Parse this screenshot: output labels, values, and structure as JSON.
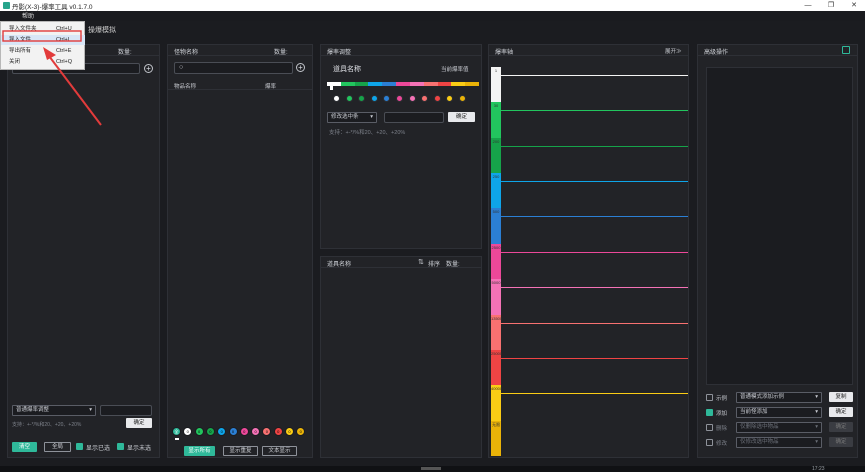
{
  "window": {
    "title": "丹影(X-3)-爆率工具 v0.1.7.0",
    "controls": [
      "—",
      "❐",
      "✕"
    ],
    "menu_help": "帮助",
    "side_hint": "操爆模拟"
  },
  "file_menu": {
    "items": [
      {
        "label": "导入文件夹",
        "shortcut": "Ctrl+U",
        "highlighted": false
      },
      {
        "label": "导入文件",
        "shortcut": "Ctrl+L",
        "highlighted": true
      },
      {
        "label": "导出所有",
        "shortcut": "Ctrl+E",
        "highlighted": false
      },
      {
        "label": "关闭",
        "shortcut": "Ctrl+Q",
        "highlighted": false
      }
    ]
  },
  "left_panel": {
    "count_label": "数量:",
    "mode_select": "普通爆率调整",
    "support_text": "支持：+-*/%和20、+20、+20%",
    "confirm_label": "确定",
    "all_btn": "清空",
    "clear_btn": "全局",
    "show_selected": "显示已选",
    "show_unselected": "显示未选"
  },
  "monster_panel": {
    "title": "怪物名称",
    "count_label": "数量:",
    "col_item": "物品名称",
    "col_rate": "爆率",
    "balls": [
      {
        "label": "全",
        "color": "#2fb99a"
      },
      {
        "label": "0",
        "color": "#ffffff"
      },
      {
        "label": "0",
        "color": "#22c55e"
      },
      {
        "label": "0",
        "color": "#16a34a"
      },
      {
        "label": "0",
        "color": "#0ea5e9"
      },
      {
        "label": "0",
        "color": "#2b7fd4"
      },
      {
        "label": "0",
        "color": "#ec4899"
      },
      {
        "label": "0",
        "color": "#f472b6"
      },
      {
        "label": "0",
        "color": "#f87171"
      },
      {
        "label": "0",
        "color": "#ef4444"
      },
      {
        "label": "0",
        "color": "#facc15"
      },
      {
        "label": "0",
        "color": "#eab308"
      }
    ],
    "btn_show_all": "显示所有",
    "btn_show_repeat": "显示重复",
    "btn_text_show": "文本显示"
  },
  "rate_panel": {
    "title": "爆率调整",
    "item_name": "道具名称",
    "current_rate": "当前爆率值",
    "dot_colors": [
      "#ffffff",
      "#22c55e",
      "#16a34a",
      "#0ea5e9",
      "#2b7fd4",
      "#ec4899",
      "#f472b6",
      "#f87171",
      "#ef4444",
      "#facc15",
      "#eab308"
    ],
    "select": "修改选中条",
    "confirm": "确定",
    "support": "支持：+-*/%和20、+20、+20%"
  },
  "item_list": {
    "col_name": "道具名称",
    "sort": "排序",
    "count": "数量:"
  },
  "rate_ruler": {
    "title": "爆率轴",
    "expand": "展开≫",
    "segments": [
      {
        "label": "1",
        "color": "#f4f4f4"
      },
      {
        "label": "30",
        "color": "#22c55e"
      },
      {
        "label": "200",
        "color": "#16a34a"
      },
      {
        "label": "250",
        "color": "#0ea5e9"
      },
      {
        "label": "500",
        "color": "#2b7fd4"
      },
      {
        "label": "2500",
        "color": "#ec4899"
      },
      {
        "label": "5000",
        "color": "#f472b6"
      },
      {
        "label": "13500",
        "color": "#f87171"
      },
      {
        "label": "25000",
        "color": "#ef4444"
      },
      {
        "label": "40000",
        "color": "#facc15"
      },
      {
        "label": "无限",
        "color": "#eab308"
      }
    ],
    "line_colors": [
      "#f4f4f4",
      "#22c55e",
      "#16a34a",
      "#0ea5e9",
      "#2b7fd4",
      "#ec4899",
      "#f472b6",
      "#f87171",
      "#ef4444",
      "#facc15"
    ]
  },
  "batch_panel": {
    "title": "高级操作",
    "rows": [
      {
        "check_label": "示例",
        "checked": false,
        "select": "普通模式添加示例",
        "button": "复制",
        "enabled": true
      },
      {
        "check_label": "添加",
        "checked": true,
        "select": "当前怪添加",
        "button": "确定",
        "enabled": true
      },
      {
        "check_label": "删除",
        "checked": false,
        "select": "仅删除选中物品",
        "button": "确定",
        "enabled": false
      },
      {
        "check_label": "修改",
        "checked": false,
        "select": "仅修改选中物品",
        "button": "确定",
        "enabled": false
      }
    ]
  },
  "footer": {
    "time": "17:23"
  }
}
